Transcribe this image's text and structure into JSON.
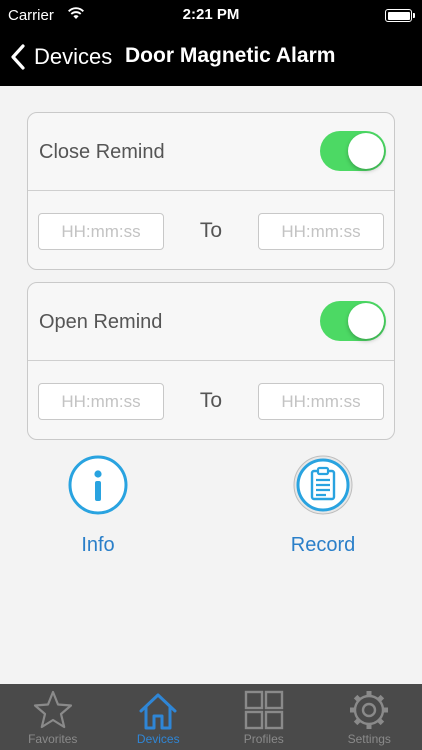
{
  "status_bar": {
    "carrier": "Carrier",
    "time": "2:21 PM"
  },
  "nav": {
    "back_label": "Devices",
    "title": "Door Magnetic Alarm"
  },
  "close_remind": {
    "title": "Close Remind",
    "enabled": true,
    "start_placeholder": "HH:mm:ss",
    "to_label": "To",
    "end_placeholder": "HH:mm:ss"
  },
  "open_remind": {
    "title": "Open Remind",
    "enabled": true,
    "start_placeholder": "HH:mm:ss",
    "to_label": "To",
    "end_placeholder": "HH:mm:ss"
  },
  "actions": {
    "info_label": "Info",
    "record_label": "Record"
  },
  "tabs": [
    {
      "label": "Favorites",
      "icon": "star-icon"
    },
    {
      "label": "Devices",
      "icon": "home-icon",
      "active": true
    },
    {
      "label": "Profiles",
      "icon": "grid-icon"
    },
    {
      "label": "Settings",
      "icon": "gear-icon"
    }
  ],
  "colors": {
    "accent": "#2f86d6",
    "toggle_on": "#4cd964",
    "tabbar_bg": "#4a4a4a",
    "nav_bg": "#000000"
  }
}
